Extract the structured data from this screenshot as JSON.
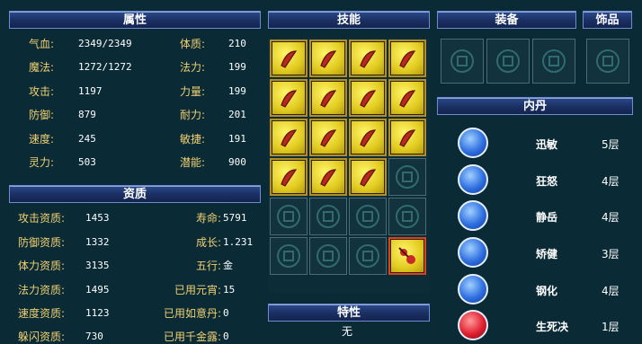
{
  "attributes": {
    "header": "属性",
    "left": [
      {
        "label": "气血:",
        "value": "2349/2349"
      },
      {
        "label": "魔法:",
        "value": "1272/1272"
      },
      {
        "label": "攻击:",
        "value": "1197"
      },
      {
        "label": "防御:",
        "value": "879"
      },
      {
        "label": "速度:",
        "value": "245"
      },
      {
        "label": "灵力:",
        "value": "503"
      }
    ],
    "right": [
      {
        "label": "体质:",
        "value": "210"
      },
      {
        "label": "法力:",
        "value": "199"
      },
      {
        "label": "力量:",
        "value": "199"
      },
      {
        "label": "耐力:",
        "value": "201"
      },
      {
        "label": "敏捷:",
        "value": "191"
      },
      {
        "label": "潜能:",
        "value": "900"
      }
    ]
  },
  "aptitude": {
    "header": "资质",
    "left": [
      {
        "label": "攻击资质:",
        "value": "1453"
      },
      {
        "label": "防御资质:",
        "value": "1332"
      },
      {
        "label": "体力资质:",
        "value": "3135"
      },
      {
        "label": "法力资质:",
        "value": "1495"
      },
      {
        "label": "速度资质:",
        "value": "1123"
      },
      {
        "label": "躲闪资质:",
        "value": "730"
      }
    ],
    "right": [
      {
        "label": "寿命:",
        "value": "5791"
      },
      {
        "label": "成长:",
        "value": "1.231"
      },
      {
        "label": "五行:",
        "value": "金"
      },
      {
        "label": "已用元宵:",
        "value": "15"
      },
      {
        "label": "已用如意丹:",
        "value": "0"
      },
      {
        "label": "已用千金露:",
        "value": "0"
      }
    ]
  },
  "skills": {
    "header": "技能",
    "icons": [
      "claw-skill-icon",
      "fist-skill-icon",
      "shield-break-skill-icon",
      "whip-skill-icon",
      "serpent-skill-icon",
      "fire-skill-icon",
      "wind-skill-icon",
      "blade-skill-icon",
      "mountain-skill-icon",
      "slash-skill-icon",
      "monk-skill-icon",
      "wisdom-skill-icon",
      "guard-skill-icon",
      "eye-skill-icon",
      "owl-skill-icon"
    ],
    "special_icon": "orb-skill-icon"
  },
  "trait": {
    "header": "特性",
    "value": "无"
  },
  "equipment": {
    "header": "装备"
  },
  "accessory": {
    "header": "饰品"
  },
  "neidan": {
    "header": "内丹",
    "items": [
      {
        "name": "迅敏",
        "level": "5层",
        "icon": "claw-orb-icon",
        "color": "#2f6fe0"
      },
      {
        "name": "狂怒",
        "level": "4层",
        "icon": "sword-orb-icon",
        "color": "#2f6fe0"
      },
      {
        "name": "静岳",
        "level": "4层",
        "icon": "figure-orb-icon",
        "color": "#2f6fe0"
      },
      {
        "name": "矫健",
        "level": "3层",
        "icon": "drop-orb-icon",
        "color": "#2f6fe0"
      },
      {
        "name": "钢化",
        "level": "4层",
        "icon": "shield-orb-icon",
        "color": "#2f6fe0"
      },
      {
        "name": "生死决",
        "level": "1层",
        "icon": "blood-orb-icon",
        "color": "#e02030"
      }
    ]
  }
}
